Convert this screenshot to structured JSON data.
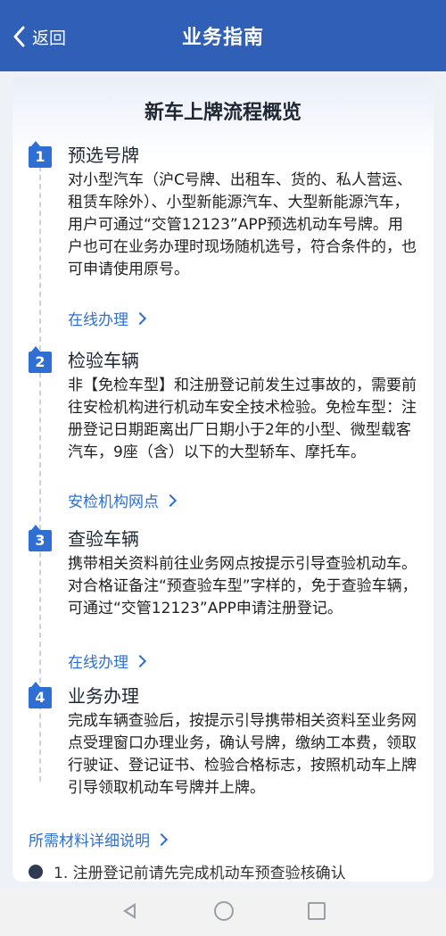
{
  "header": {
    "back_label": "返回",
    "title": "业务指南"
  },
  "card": {
    "title": "新车上牌流程概览",
    "steps": [
      {
        "number": "1",
        "title": "预选号牌",
        "desc": "对小型汽车（沪C号牌、出租车、货的、私人营运、租赁车除外）、小型新能源汽车、大型新能源汽车，用户可通过“交管12123”APP预选机动车号牌。用户也可在业务办理时现场随机选号，符合条件的，也可申请使用原号。",
        "link": "在线办理"
      },
      {
        "number": "2",
        "title": "检验车辆",
        "desc": "非【免检车型】和注册登记前发生过事故的，需要前往安检机构进行机动车安全技术检验。免检车型：注册登记日期距离出厂日期小于2年的小型、微型载客汽车，9座（含）以下的大型轿车、摩托车。",
        "link": "安检机构网点"
      },
      {
        "number": "3",
        "title": "查验车辆",
        "desc": "携带相关资料前往业务网点按提示引导查验机动车。对合格证备注“预查验车型”字样的，免于查验车辆，可通过“交管12123”APP申请注册登记。",
        "link": "在线办理"
      },
      {
        "number": "4",
        "title": "业务办理",
        "desc": "完成车辆查验后，按提示引导携带相关资料至业务网点受理窗口办理业务，确认号牌，缴纳工本费，领取行驶证、登记证书、检验合格标志，按照机动车上牌引导领取机动车号牌并上牌。",
        "link": ""
      }
    ],
    "bottom_link": "所需材料详细说明",
    "cut_off_text": "1. 注册登记前请先完成机动车预查验核确认"
  },
  "icons": {
    "back": "chevron-left-icon",
    "link": "chevron-right-icon"
  },
  "colors": {
    "header_bg": "#2f5fb6",
    "accent": "#2f6fd3"
  }
}
